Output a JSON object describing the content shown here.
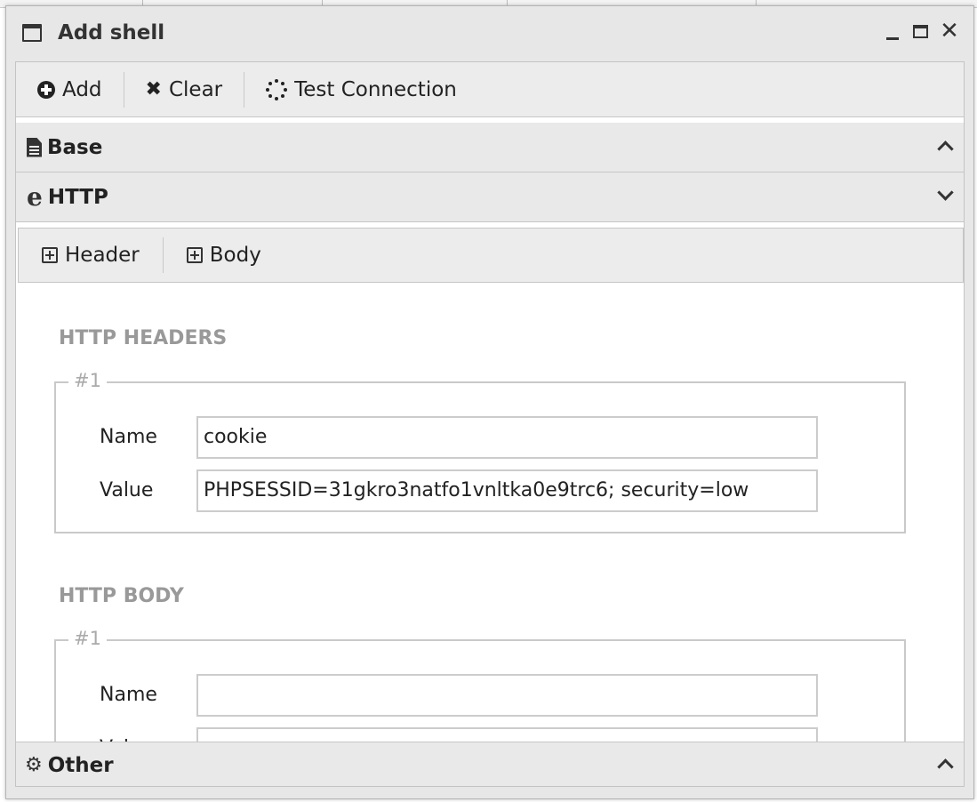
{
  "window": {
    "title": "Add shell",
    "controls": [
      "minimize-icon",
      "maximize-icon",
      "close-icon"
    ]
  },
  "toolbar": {
    "add_label": "Add",
    "clear_label": "Clear",
    "test_label": "Test Connection"
  },
  "accordion": {
    "base_title": "Base",
    "http_title": "HTTP",
    "other_title": "Other"
  },
  "http_toolbar": {
    "header_label": "Header",
    "body_label": "Body"
  },
  "headers_section": {
    "title": "HTTP HEADERS",
    "group_legend": "#1",
    "name_label": "Name",
    "name_value": "cookie",
    "value_label": "Value",
    "value_value": "PHPSESSID=31gkro3natfo1vnltka0e9trc6; security=low"
  },
  "body_section": {
    "title": "HTTP BODY",
    "group_legend": "#1",
    "name_label": "Name",
    "name_value": "",
    "value_label": "Value",
    "value_value": ""
  },
  "icons": {
    "window": "window-icon",
    "add": "plus-circle-icon",
    "clear": "times-icon",
    "test": "spinner-icon",
    "base": "file-text-icon",
    "http": "edge-browser-icon",
    "other": "gears-icon",
    "header": "plus-square-icon",
    "body": "plus-square-icon"
  }
}
